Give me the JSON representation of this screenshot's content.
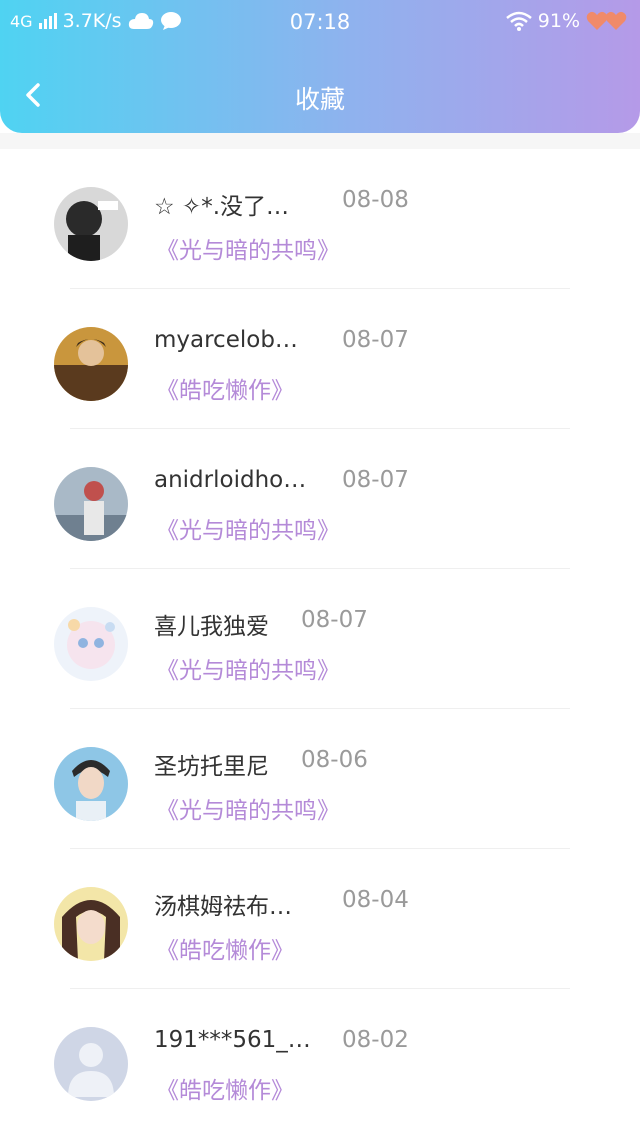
{
  "status_bar": {
    "network": "4G",
    "speed": "3.7K/s",
    "time": "07:18",
    "battery": "91%"
  },
  "header": {
    "title": "收藏"
  },
  "items": [
    {
      "name": "☆ ✧*.没了…",
      "date": "08-08",
      "work": "《光与暗的共鸣》"
    },
    {
      "name": "myarcelob…",
      "date": "08-07",
      "work": "《皓吃懒作》"
    },
    {
      "name": "anidrloidho…",
      "date": "08-07",
      "work": "《光与暗的共鸣》"
    },
    {
      "name": "喜儿我独爱",
      "date": "08-07",
      "work": "《光与暗的共鸣》"
    },
    {
      "name": "圣坊托里尼",
      "date": "08-06",
      "work": "《光与暗的共鸣》"
    },
    {
      "name": "汤棋姆祛布…",
      "date": "08-04",
      "work": "《皓吃懒作》"
    },
    {
      "name": "191***561_…",
      "date": "08-02",
      "work": "《皓吃懒作》"
    }
  ],
  "colors": {
    "accent": "#b48ad8",
    "header_start": "#4fd3f2",
    "header_end": "#b59ae8"
  }
}
